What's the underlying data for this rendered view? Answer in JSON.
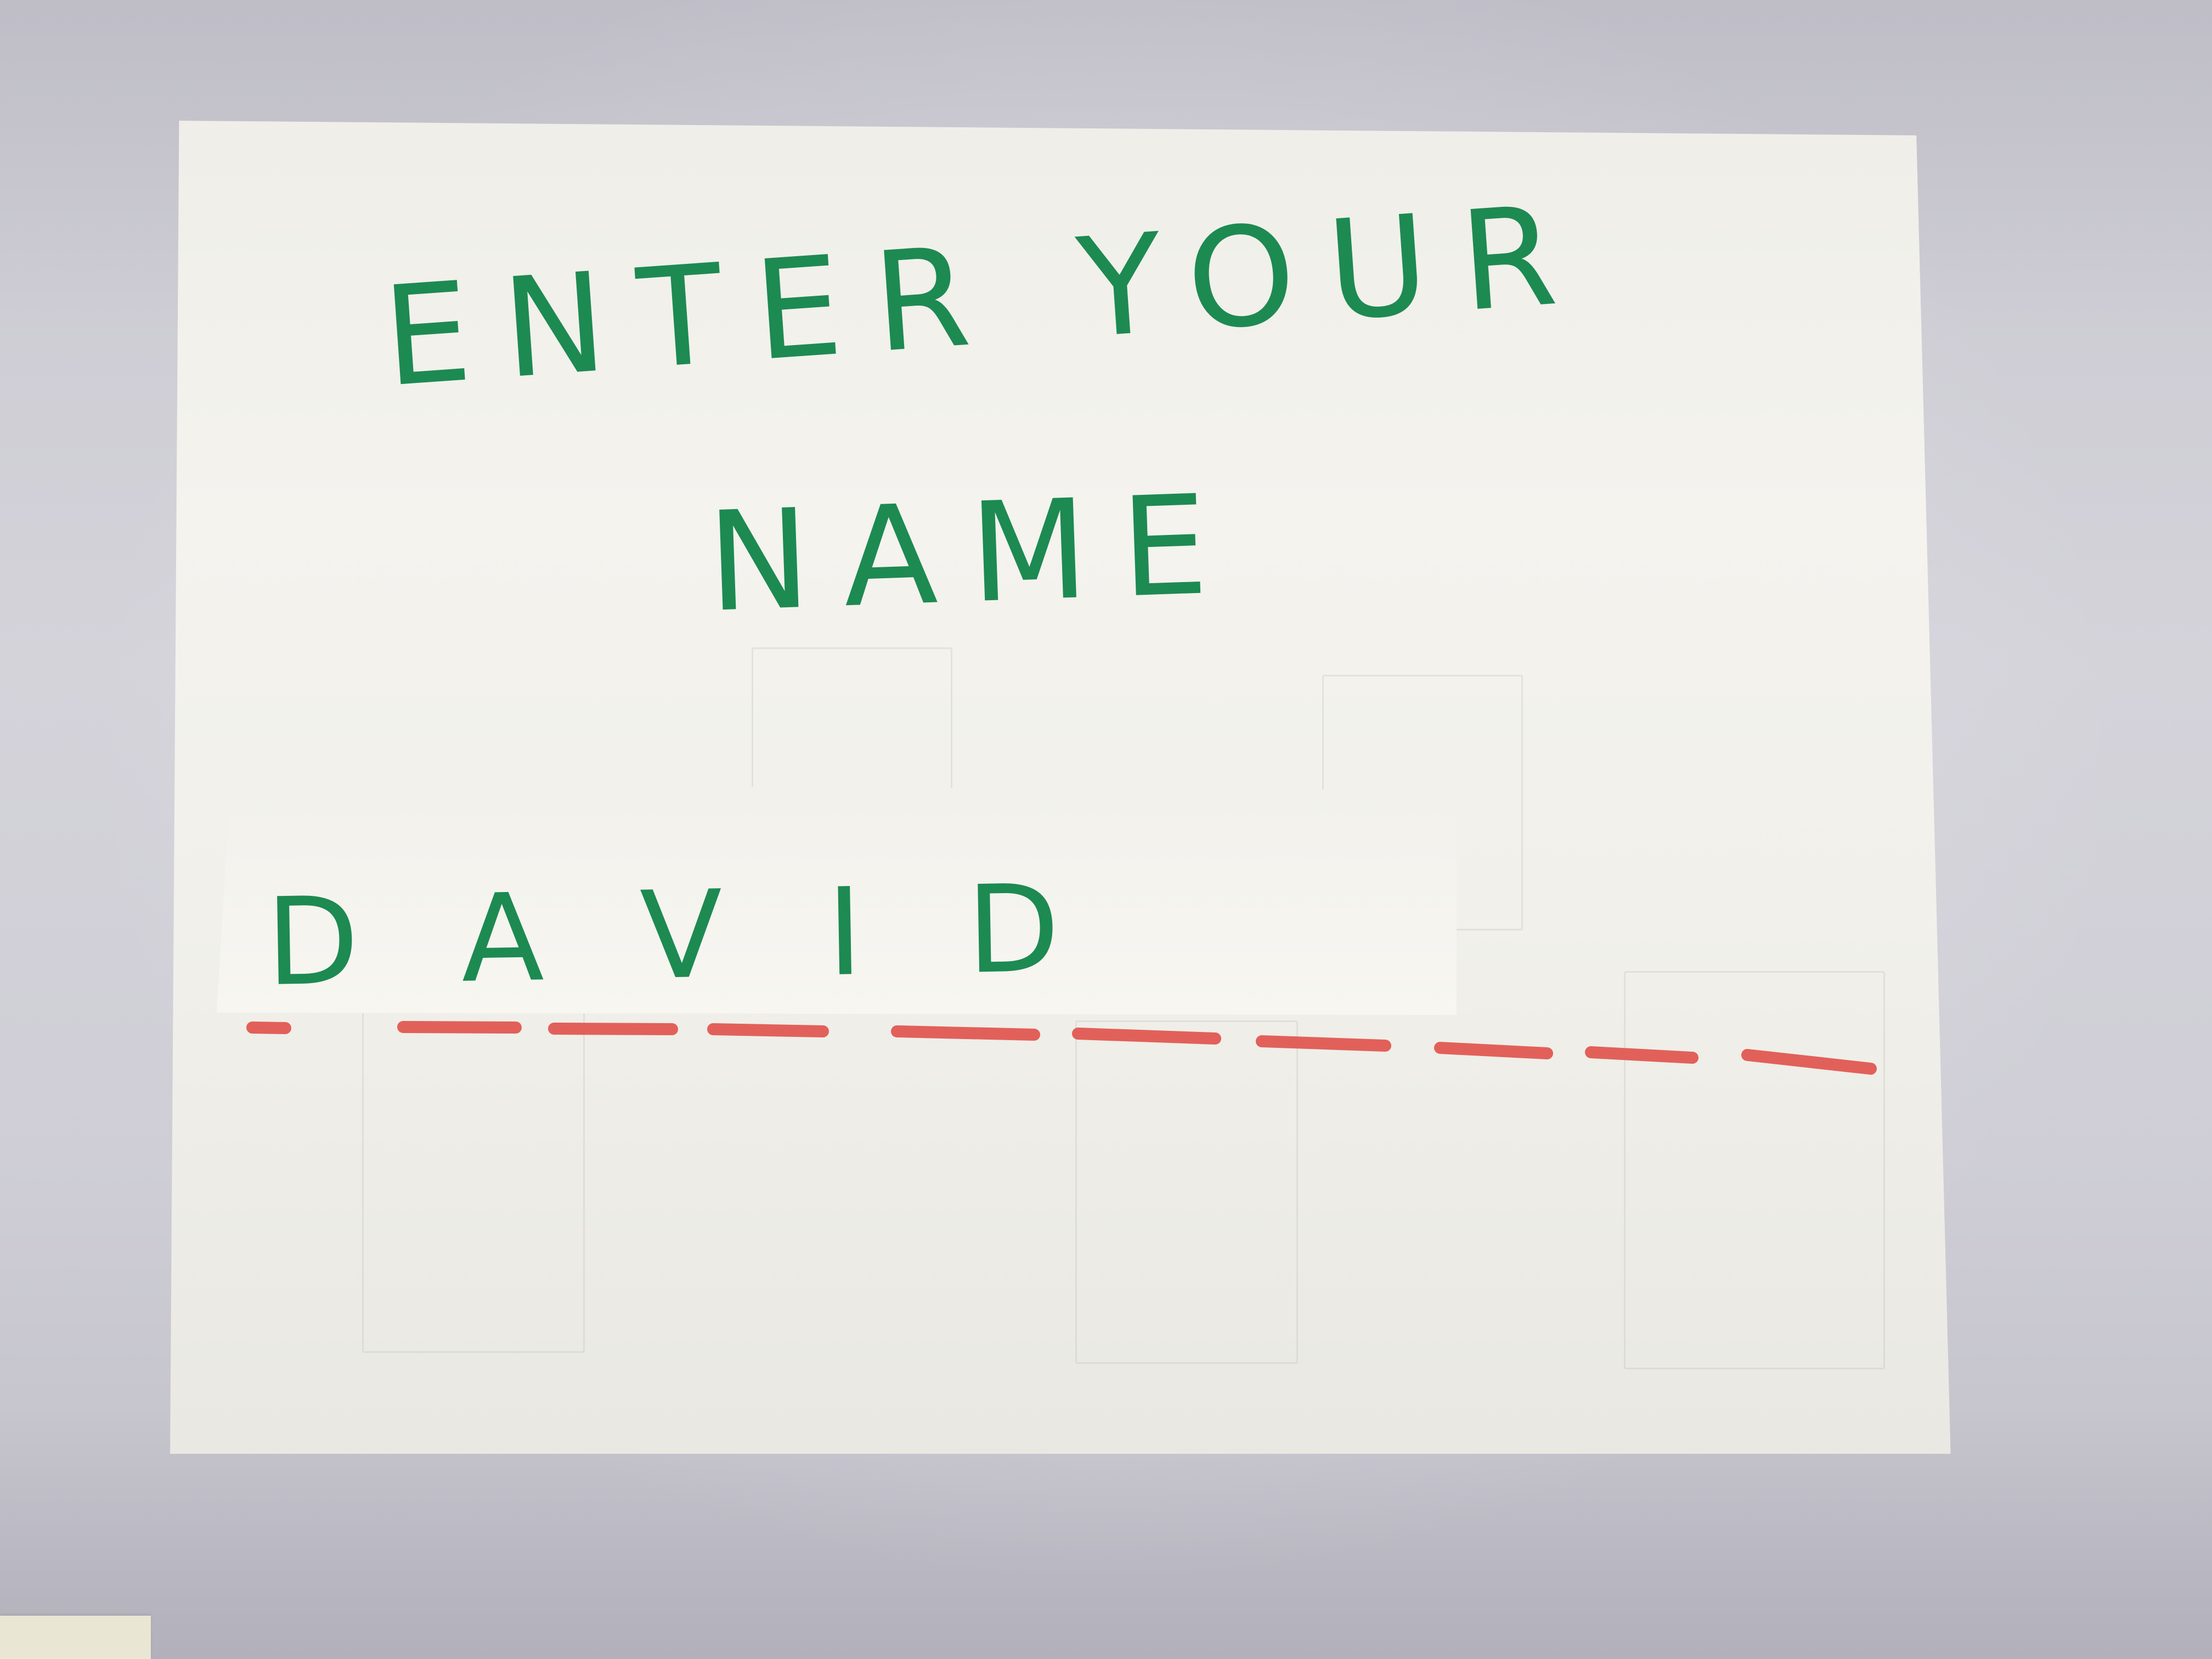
{
  "prompt": {
    "line1": "ENTER YOUR",
    "line2": "NAME"
  },
  "name_field": {
    "value": "DAVID"
  },
  "colors": {
    "ink_green": "#1d8a52",
    "underline_red": "#e2605a",
    "paper": "#f1f0ea"
  }
}
